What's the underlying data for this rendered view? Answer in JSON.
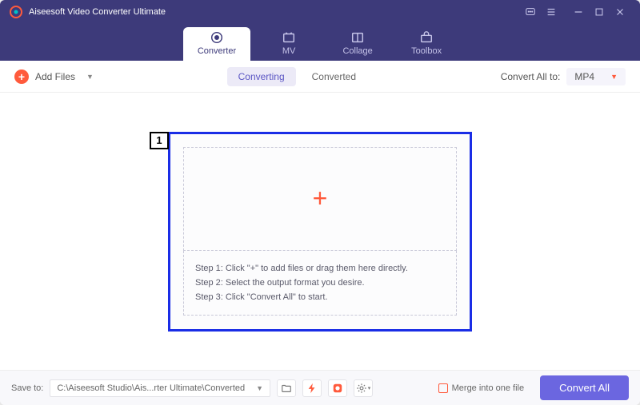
{
  "app": {
    "title": "Aiseesoft Video Converter Ultimate"
  },
  "tabs": {
    "converter": "Converter",
    "mv": "MV",
    "collage": "Collage",
    "toolbox": "Toolbox"
  },
  "toolbar": {
    "add_files": "Add Files",
    "converting": "Converting",
    "converted": "Converted",
    "convert_all_to": "Convert All to:",
    "format": "MP4"
  },
  "callout": {
    "number": "1"
  },
  "steps": {
    "s1": "Step 1: Click \"+\" to add files or drag them here directly.",
    "s2": "Step 2: Select the output format you desire.",
    "s3": "Step 3: Click \"Convert All\" to start."
  },
  "footer": {
    "save_to": "Save to:",
    "path": "C:\\Aiseesoft Studio\\Ais...rter Ultimate\\Converted",
    "merge": "Merge into one file",
    "convert_all": "Convert All"
  }
}
